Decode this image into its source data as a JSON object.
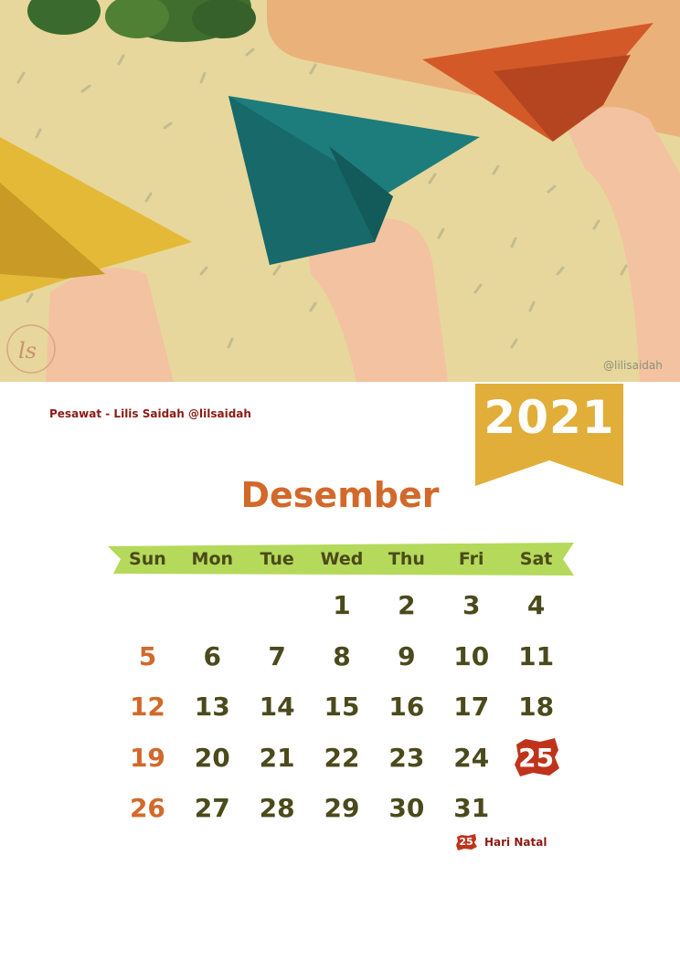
{
  "illustration": {
    "signature": "@lilisaidah",
    "monogram": "ls"
  },
  "credit": "Pesawat - Lilis Saidah @lilsaidah",
  "year": "2021",
  "month": "Desember",
  "weekdays": [
    "Sun",
    "Mon",
    "Tue",
    "Wed",
    "Thu",
    "Fri",
    "Sat"
  ],
  "weeks": [
    [
      "",
      "",
      "",
      "1",
      "2",
      "3",
      "4"
    ],
    [
      "5",
      "6",
      "7",
      "8",
      "9",
      "10",
      "11"
    ],
    [
      "12",
      "13",
      "14",
      "15",
      "16",
      "17",
      "18"
    ],
    [
      "19",
      "20",
      "21",
      "22",
      "23",
      "24",
      "25"
    ],
    [
      "26",
      "27",
      "28",
      "29",
      "30",
      "31",
      ""
    ]
  ],
  "holiday": {
    "day": "25",
    "label": "Hari Natal"
  },
  "colors": {
    "accent_orange": "#d2692a",
    "ribbon_gold": "#e1ae3a",
    "header_green": "#b5d95a",
    "holiday_red": "#c0331b",
    "text_dark": "#4b4a1c"
  }
}
